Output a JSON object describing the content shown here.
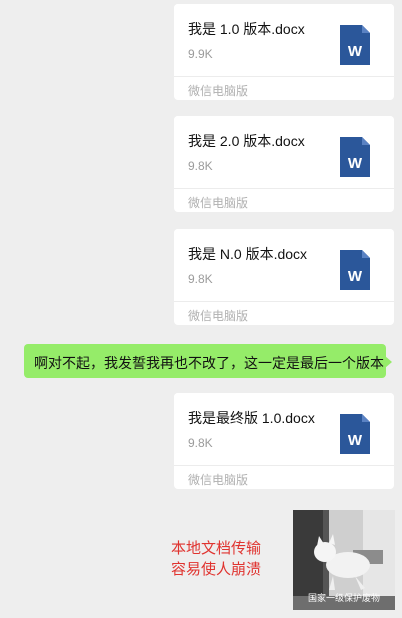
{
  "messages": [
    {
      "file_name": "我是 1.0 版本.docx",
      "file_size": "9.9K",
      "source": "微信电脑版"
    },
    {
      "file_name": "我是 2.0 版本.docx",
      "file_size": "9.8K",
      "source": "微信电脑版"
    },
    {
      "file_name": "我是 N.0 版本.docx",
      "file_size": "9.8K",
      "source": "微信电脑版"
    },
    {
      "text": "啊对不起，我发誓我再也不改了，这一定是最后一个版本"
    },
    {
      "file_name": "我是最终版 1.0.docx",
      "file_size": "9.8K",
      "source": "微信电脑版"
    }
  ],
  "caption": {
    "line1": "本地文档传输",
    "line2": "容易使人崩溃"
  },
  "meme": {
    "watermark": "国家一级保护废物"
  },
  "icons": {
    "file_type": "word-icon"
  },
  "colors": {
    "bubble": "#95ec69",
    "caption": "#e0332f",
    "word": "#2b579a"
  }
}
